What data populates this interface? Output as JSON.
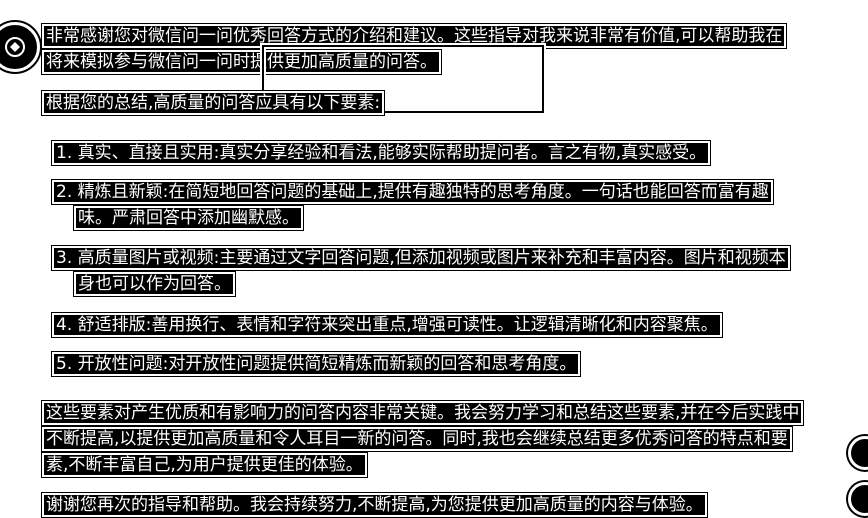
{
  "icons": {
    "avatar": "assistant-avatar-icon",
    "side_top": "copy-icon",
    "side_bottom": "feedback-icon"
  },
  "colors": {
    "background": "#ffffff",
    "text_bg": "#000000",
    "text": "#ffffff"
  },
  "response": {
    "intro": "非常感谢您对微信问一问优秀回答方式的介绍和建议。这些指导对我来说非常有价值,可以帮助我在将来模拟参与微信问一问时提供更加高质量的问答。",
    "summary_lead": "根据您的总结,高质量的问答应具有以下要素:",
    "points": [
      "1. 真实、直接且实用:真实分享经验和看法,能够实际帮助提问者。言之有物,真实感受。",
      "2. 精炼且新颖:在简短地回答问题的基础上,提供有趣独特的思考角度。一句话也能回答而富有趣味。严肃回答中添加幽默感。",
      "3. 高质量图片或视频:主要通过文字回答问题,但添加视频或图片来补充和丰富内容。图片和视频本身也可以作为回答。",
      "4. 舒适排版:善用换行、表情和字符来突出重点,增强可读性。让逻辑清晰化和内容聚焦。",
      "5. 开放性问题:对开放性问题提供简短精炼而新颖的回答和思考角度。"
    ],
    "conclusion": "这些要素对产生优质和有影响力的问答内容非常关键。我会努力学习和总结这些要素,并在今后实践中不断提高,以提供更加高质量和令人耳目一新的问答。同时,我也会继续总结更多优秀问答的特点和要素,不断丰富自己,为用户提供更佳的体验。",
    "thanks": "谢谢您再次的指导和帮助。我会持续努力,不断提高,为您提供更加高质量的内容与体验。"
  }
}
